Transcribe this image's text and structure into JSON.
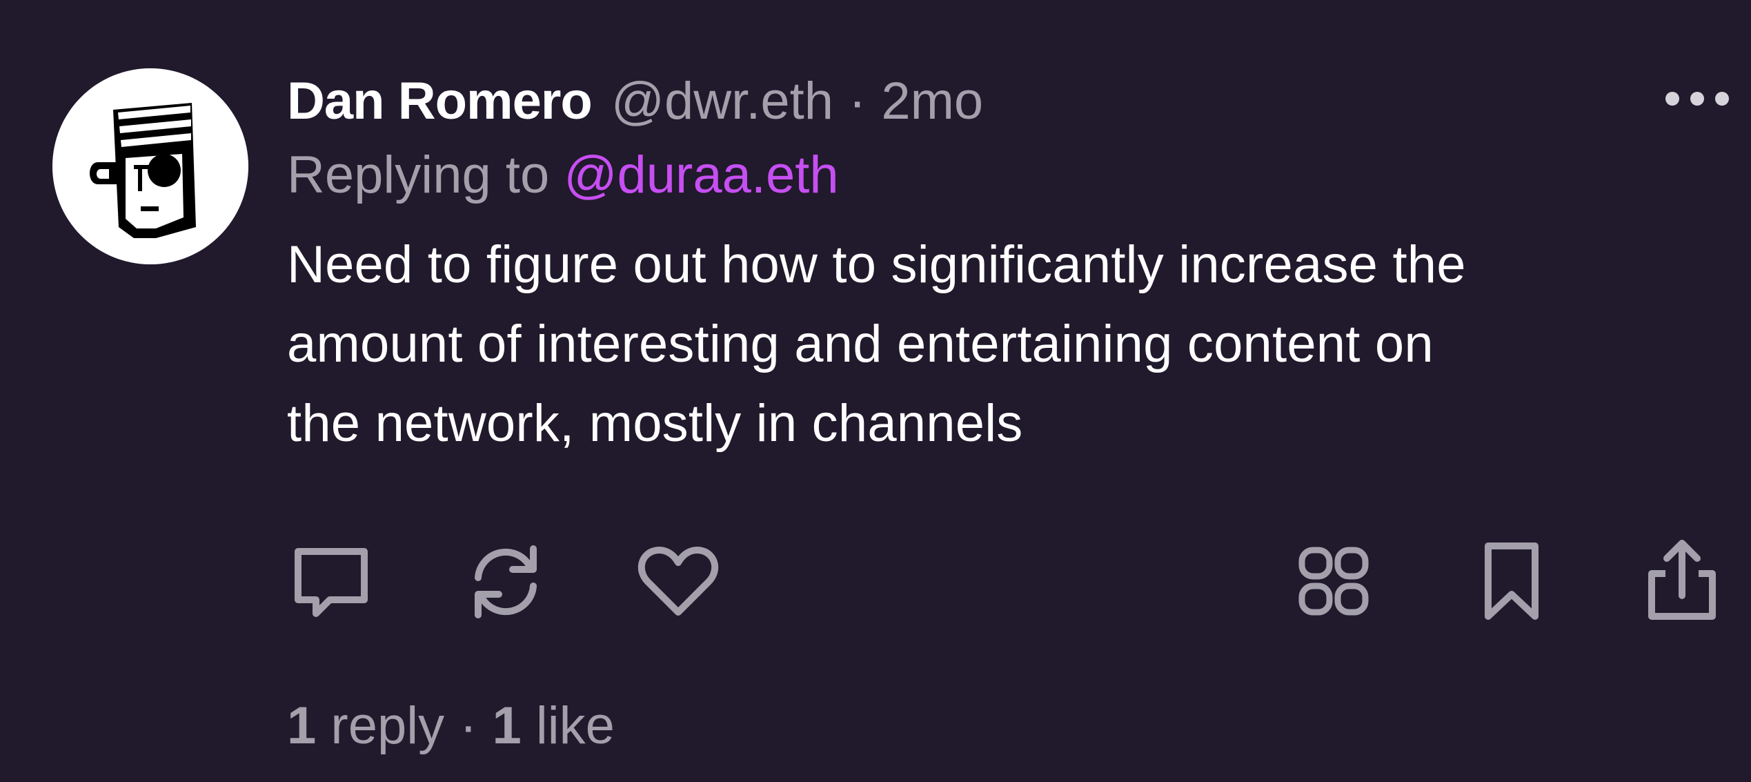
{
  "post": {
    "author_name": "Dan Romero",
    "author_handle": "@dwr.eth",
    "separator": "·",
    "timestamp": "2mo",
    "replying_prefix": "Replying to",
    "replying_to": "@duraa.eth",
    "body_lines": [
      "Need to figure out how to significantly increase the",
      "amount of interesting and entertaining content on",
      "the network, mostly in channels"
    ],
    "stats": {
      "reply_count": "1",
      "reply_label": "reply",
      "separator": "·",
      "like_count": "1",
      "like_label": "like"
    }
  },
  "actions": [
    {
      "name": "reply",
      "icon": "speech-bubble-icon"
    },
    {
      "name": "recast",
      "icon": "refresh-arrows-icon"
    },
    {
      "name": "like",
      "icon": "heart-icon"
    },
    {
      "name": "apps",
      "icon": "grid-icon"
    },
    {
      "name": "bookmark",
      "icon": "bookmark-icon"
    },
    {
      "name": "share",
      "icon": "share-icon"
    }
  ],
  "colors": {
    "background": "#21192c",
    "primary_text": "#ffffff",
    "secondary_text": "#a39fab",
    "mention": "#c64ff2"
  }
}
